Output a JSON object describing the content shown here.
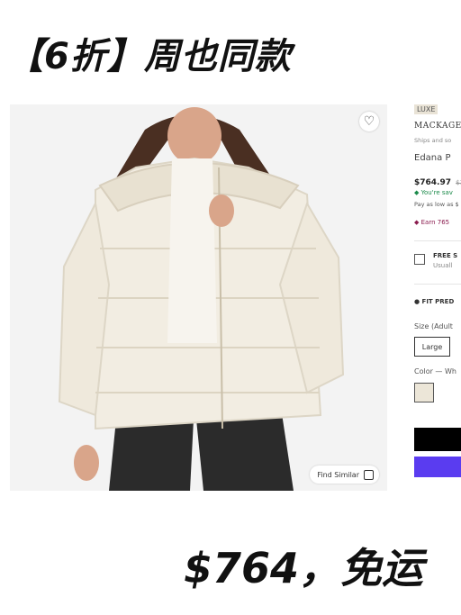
{
  "headline": "【6折】周也同款",
  "price_banner": "$764，免运",
  "photo": {
    "wishlist_icon": "♡",
    "find_similar_label": "Find Similar"
  },
  "panel": {
    "badge": "LUXE",
    "brand": "MACKAGE",
    "ships": "Ships and so",
    "product_name": "Edana P",
    "price": "$764.97",
    "was_price": "$1",
    "saving": "You're sav",
    "pay_as_low": "Pay as low as $",
    "earn": "Earn 765",
    "shipping_title": "FREE S",
    "shipping_sub": "Usuall",
    "fit_predictor": "FIT PRED",
    "size_label": "Size (Adult",
    "size_value": "Large",
    "color_label": "Color — Wh"
  },
  "colors": {
    "coat": "#f2ede2",
    "pants": "#2b2b2b",
    "purple_button": "#5a3cf0"
  }
}
